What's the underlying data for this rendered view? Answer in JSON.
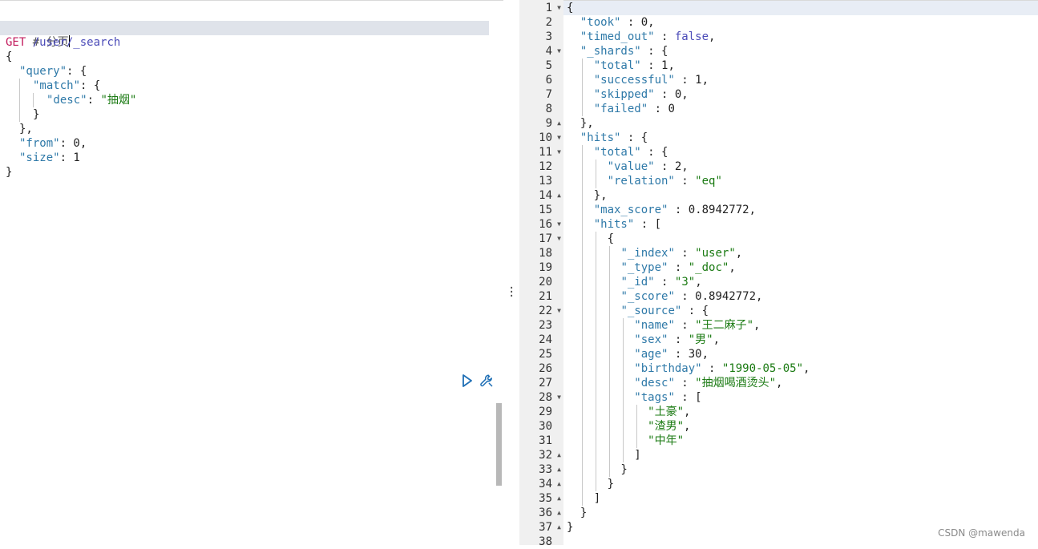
{
  "request": {
    "comment": "# 分页",
    "method": "GET",
    "path": "/user/_search",
    "lines": {
      "l3": "{",
      "l4_key": "\"query\"",
      "l4_rest": ": {",
      "l5_key": "\"match\"",
      "l5_rest": ": {",
      "l6_key": "\"desc\"",
      "l6_sep": ": ",
      "l6_val": "\"抽烟\"",
      "l7": "}",
      "l8": "},",
      "l9_key": "\"from\"",
      "l9_rest": ": 0,",
      "l10_key": "\"size\"",
      "l10_rest": ": 1",
      "l11": "}"
    }
  },
  "toolbar": {
    "run_icon": "play-icon",
    "settings_icon": "wrench-icon"
  },
  "response": {
    "line_numbers": [
      "1",
      "2",
      "3",
      "4",
      "5",
      "6",
      "7",
      "8",
      "9",
      "10",
      "11",
      "12",
      "13",
      "14",
      "15",
      "16",
      "17",
      "18",
      "19",
      "20",
      "21",
      "22",
      "23",
      "24",
      "25",
      "26",
      "27",
      "28",
      "29",
      "30",
      "31",
      "32",
      "33",
      "34",
      "35",
      "36",
      "37",
      "38"
    ],
    "fold_open_lines": [
      "1",
      "4",
      "10",
      "11",
      "16",
      "17",
      "22",
      "28"
    ],
    "fold_close_lines": [
      "9",
      "14",
      "32",
      "33",
      "34",
      "35",
      "36",
      "37"
    ],
    "lines": [
      "{",
      "  \"took\" : 0,",
      "  \"timed_out\" : false,",
      "  \"_shards\" : {",
      "    \"total\" : 1,",
      "    \"successful\" : 1,",
      "    \"skipped\" : 0,",
      "    \"failed\" : 0",
      "  },",
      "  \"hits\" : {",
      "    \"total\" : {",
      "      \"value\" : 2,",
      "      \"relation\" : \"eq\"",
      "    },",
      "    \"max_score\" : 0.8942772,",
      "    \"hits\" : [",
      "      {",
      "        \"_index\" : \"user\",",
      "        \"_type\" : \"_doc\",",
      "        \"_id\" : \"3\",",
      "        \"_score\" : 0.8942772,",
      "        \"_source\" : {",
      "          \"name\" : \"王二麻子\",",
      "          \"sex\" : \"男\",",
      "          \"age\" : 30,",
      "          \"birthday\" : \"1990-05-05\",",
      "          \"desc\" : \"抽烟喝酒烫头\",",
      "          \"tags\" : [",
      "            \"土豪\",",
      "            \"渣男\",",
      "            \"中年\"",
      "          ]",
      "        }",
      "      }",
      "    ]",
      "  }",
      "}",
      ""
    ]
  },
  "watermark": "CSDN @mawenda",
  "colors": {
    "key": "#2e79a8",
    "string": "#1a7a12",
    "method": "#c2185b",
    "boolean": "#4b4bb8",
    "gutter": "#f0f0f0",
    "active_line": "#dfe3ea"
  }
}
